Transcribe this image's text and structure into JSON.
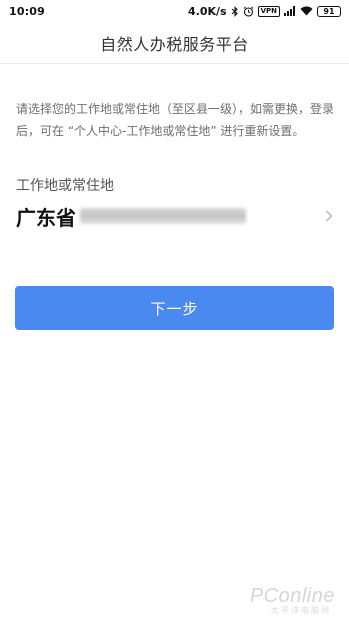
{
  "status_bar": {
    "time": "10:09",
    "network_speed": "4.0K/s",
    "vpn_label": "VPN",
    "battery": "91",
    "icons": [
      "bluetooth-icon",
      "alarm-icon",
      "vpn-icon",
      "signal-icon",
      "wifi-icon",
      "battery-icon"
    ]
  },
  "header": {
    "title": "自然人办税服务平台"
  },
  "notice": {
    "text": "请选择您的工作地或常住地（至区县一级），如需更换，登录后，可在 “个人中心-工作地或常住地” 进行重新设置。"
  },
  "location": {
    "label": "工作地或常住地",
    "province": "广东省",
    "chevron_icon": "chevron-right-icon"
  },
  "actions": {
    "next_label": "下一步"
  },
  "watermark": {
    "brand": "PConline",
    "sub": "太平洋电脑网"
  },
  "colors": {
    "primary_button": "#4a8af0",
    "notice_text": "#6e6e6e",
    "divider": "#ececec"
  }
}
